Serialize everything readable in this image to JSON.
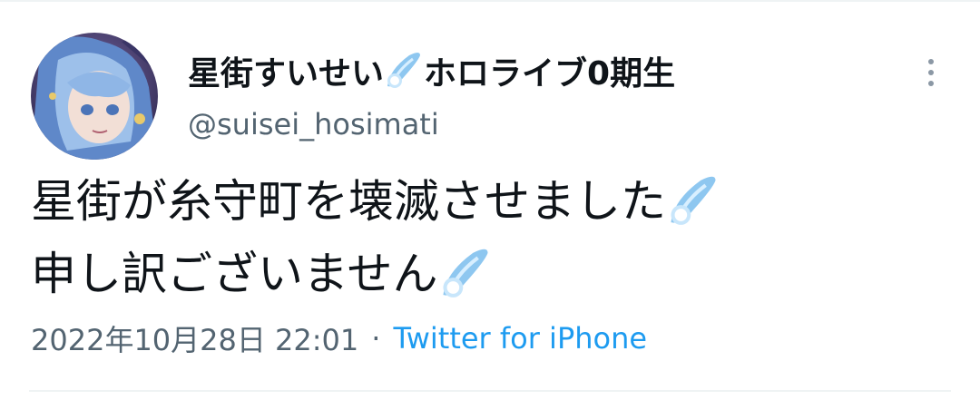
{
  "author": {
    "display_name_text": "星街すいせい",
    "display_name_suffix": "ホロライブ0期生",
    "handle": "@suisei_hosimati",
    "avatar_icon": "avatar-image"
  },
  "tweet": {
    "line1": "星街が糸守町を壊滅させました",
    "line2": "申し訳ございません",
    "emoji_icon": "comet-icon"
  },
  "meta": {
    "timestamp": "2022年10月28日 22:01",
    "separator": "·",
    "source": "Twitter for iPhone"
  },
  "colors": {
    "text": "#0f1419",
    "secondary": "#536471",
    "link": "#1d9bf0",
    "divider": "#eff3f4"
  }
}
